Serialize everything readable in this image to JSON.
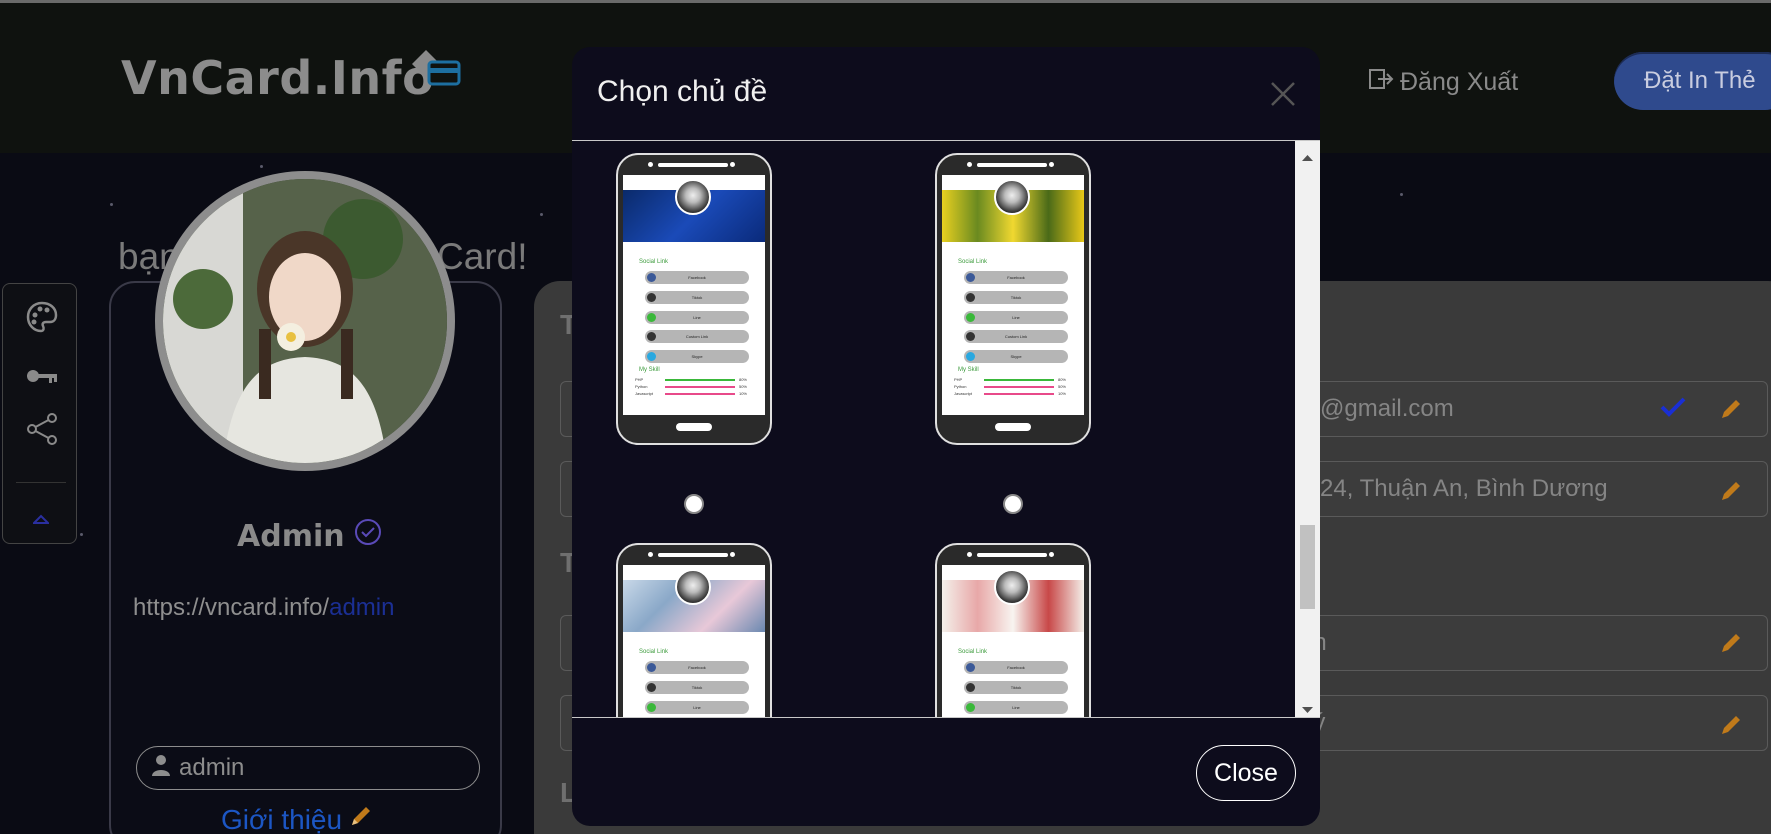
{
  "header": {
    "logo": "VnCard.Info",
    "logout_label": "Đăng Xuất",
    "order_button": "Đặt In Thẻ"
  },
  "welcome": {
    "left": "bạn",
    "right": "Card!"
  },
  "profile": {
    "name": "Admin",
    "url_prefix": "https://vncard.info/",
    "url_user": "admin",
    "username_value": "admin",
    "intro_label": "Giới thiệu"
  },
  "form": {
    "email_value": "tu@gmail.com",
    "address_value": "a 24, Thuận An, Bình Dương",
    "field3_value": "an",
    "field4_value": "uý",
    "label_t1": "T",
    "label_t2": "T",
    "label_l": "L"
  },
  "modal": {
    "title": "Chọn chủ đề",
    "close_label": "Close",
    "themes": [
      {
        "theme": "blue-tech",
        "social_label": "Social Link",
        "skill_label": "My Skill",
        "links": [
          "Facebook",
          "Tiktok",
          "Line",
          "Custom Link",
          "Skype"
        ],
        "skills": [
          {
            "name": "PHP",
            "value": "80%"
          },
          {
            "name": "Python",
            "value": "50%"
          },
          {
            "name": "Javascript",
            "value": "10%"
          }
        ]
      },
      {
        "theme": "yellow-flowers",
        "social_label": "Social Link",
        "skill_label": "My Skill",
        "links": [
          "Facebook",
          "Tiktok",
          "Line",
          "Custom Link",
          "Skype"
        ],
        "skills": [
          {
            "name": "PHP",
            "value": "80%"
          },
          {
            "name": "Python",
            "value": "50%"
          },
          {
            "name": "Javascript",
            "value": "10%"
          }
        ]
      },
      {
        "theme": "cherry-blossom",
        "social_label": "Social Link",
        "links": [
          "Facebook",
          "Tiktok",
          "Line"
        ]
      },
      {
        "theme": "plum-blossom",
        "social_label": "Social Link",
        "links": [
          "Facebook",
          "Tiktok",
          "Line"
        ]
      }
    ]
  },
  "colors": {
    "accent_blue": "#2f4a8d",
    "edit_orange": "#c07a1a",
    "check_blue": "#1a2fd4",
    "link_blue": "#1c56c4"
  }
}
